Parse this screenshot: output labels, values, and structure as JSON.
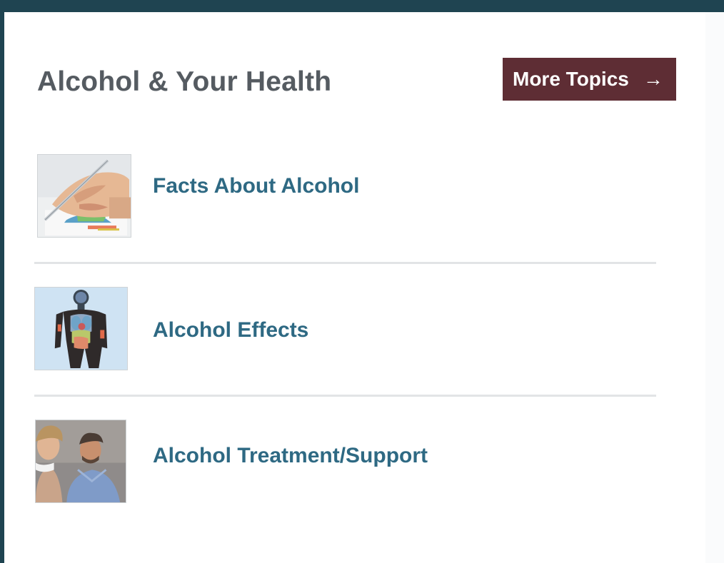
{
  "section": {
    "title": "Alcohol & Your Health",
    "more_button": {
      "label": "More Topics",
      "arrow": "→"
    }
  },
  "topics": [
    {
      "label": "Facts About Alcohol",
      "thumbnail_icon": "hand-writing-chart-image"
    },
    {
      "label": "Alcohol Effects",
      "thumbnail_icon": "human-body-organs-image"
    },
    {
      "label": "Alcohol Treatment/Support",
      "thumbnail_icon": "counseling-people-image"
    }
  ],
  "colors": {
    "frame": "#1f4451",
    "title": "#555b61",
    "button_bg": "#5e2d34",
    "link": "#2e6983",
    "divider": "#e2e4e6"
  }
}
